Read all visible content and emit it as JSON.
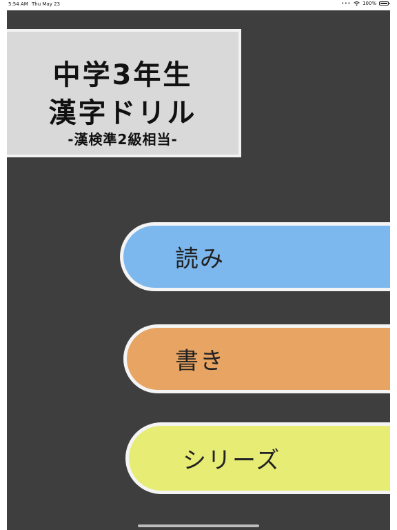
{
  "status_bar": {
    "time": "5:54 AM",
    "date": "Thu May 23",
    "dots": "•••",
    "wifi_icon": "wifi-icon",
    "battery_percent": "100%",
    "battery_icon": "battery-icon"
  },
  "title_card": {
    "line1": "中学3年生",
    "line2": "漢字ドリル",
    "subtitle": "-漢検準2級相当-"
  },
  "menu": {
    "items": [
      {
        "label": "読み",
        "color": "#7cb8ee"
      },
      {
        "label": "書き",
        "color": "#e8a462"
      },
      {
        "label": "シリーズ",
        "color": "#e7ec75"
      }
    ]
  },
  "colors": {
    "background": "#3e3e3e",
    "title_card": "#d9d9d9",
    "button_border": "#f4f4f4"
  }
}
